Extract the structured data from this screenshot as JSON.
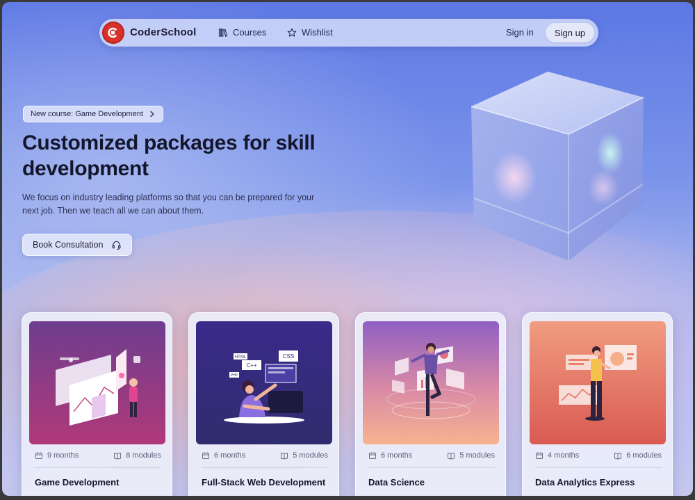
{
  "nav": {
    "brand": "CoderSchool",
    "courses": "Courses",
    "wishlist": "Wishlist",
    "signin": "Sign in",
    "signup": "Sign up"
  },
  "hero": {
    "badge": "New course: Game Development",
    "title": "Customized packages for skill development",
    "description": "We focus on industry leading platforms so that you can be prepared for your next job. Then we teach all we can about them.",
    "cta": "Book Consultation"
  },
  "cards": [
    {
      "duration": "9 months",
      "modules": "8 modules",
      "title": "Game Development"
    },
    {
      "duration": "6 months",
      "modules": "5 modules",
      "title": "Full-Stack Web Development"
    },
    {
      "duration": "6 months",
      "modules": "5 modules",
      "title": "Data Science"
    },
    {
      "duration": "4 months",
      "modules": "6 modules",
      "title": "Data Analytics Express"
    }
  ],
  "illustration_text": {
    "html": "HTML",
    "cpp": "C++",
    "css": "CSS",
    "php": "PHP"
  },
  "colors": {
    "brand_red": "#d8322a",
    "game_bg": "#7a3a8f",
    "web_bg": "#3b2f86",
    "ds_bg": "#9f6fc4",
    "da_bg": "#e0705f"
  }
}
